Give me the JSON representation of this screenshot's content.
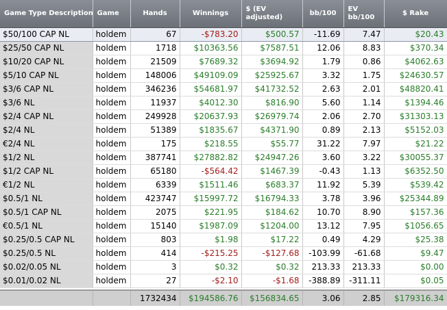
{
  "colors": {
    "positive": "#2a7d2a",
    "negative": "#a41c1c",
    "header_bg": "#7c8189",
    "label_col_bg": "#d9d9d9"
  },
  "headers": [
    "Game Type Description",
    "Game",
    "Hands",
    "Winnings",
    "$ (EV adjusted)",
    "bb/100",
    "EV bb/100",
    "$ Rake"
  ],
  "rows": [
    {
      "desc": "$50/100 CAP NL",
      "game": "holdem",
      "hands": "67",
      "win": "-$783.20",
      "ev": "$500.57",
      "bb": "-11.69",
      "evbb": "7.47",
      "rake": "$20.43"
    },
    {
      "desc": "$25/50 CAP NL",
      "game": "holdem",
      "hands": "1718",
      "win": "$10363.56",
      "ev": "$7587.51",
      "bb": "12.06",
      "evbb": "8.83",
      "rake": "$370.34"
    },
    {
      "desc": "$10/20 CAP NL",
      "game": "holdem",
      "hands": "21509",
      "win": "$7689.32",
      "ev": "$3694.92",
      "bb": "1.79",
      "evbb": "0.86",
      "rake": "$4062.63"
    },
    {
      "desc": "$5/10 CAP NL",
      "game": "holdem",
      "hands": "148006",
      "win": "$49109.09",
      "ev": "$25925.67",
      "bb": "3.32",
      "evbb": "1.75",
      "rake": "$24630.57"
    },
    {
      "desc": "$3/6 CAP NL",
      "game": "holdem",
      "hands": "346236",
      "win": "$54681.97",
      "ev": "$41732.52",
      "bb": "2.63",
      "evbb": "2.01",
      "rake": "$48820.41"
    },
    {
      "desc": "$3/6 NL",
      "game": "holdem",
      "hands": "11937",
      "win": "$4012.30",
      "ev": "$816.90",
      "bb": "5.60",
      "evbb": "1.14",
      "rake": "$1394.46"
    },
    {
      "desc": "$2/4 CAP NL",
      "game": "holdem",
      "hands": "249928",
      "win": "$20637.93",
      "ev": "$26979.74",
      "bb": "2.06",
      "evbb": "2.70",
      "rake": "$31303.13"
    },
    {
      "desc": "$2/4 NL",
      "game": "holdem",
      "hands": "51389",
      "win": "$1835.67",
      "ev": "$4371.90",
      "bb": "0.89",
      "evbb": "2.13",
      "rake": "$5152.03"
    },
    {
      "desc": "€2/4 NL",
      "game": "holdem",
      "hands": "175",
      "win": "$218.55",
      "ev": "$55.77",
      "bb": "31.22",
      "evbb": "7.97",
      "rake": "$21.22"
    },
    {
      "desc": "$1/2 NL",
      "game": "holdem",
      "hands": "387741",
      "win": "$27882.82",
      "ev": "$24947.26",
      "bb": "3.60",
      "evbb": "3.22",
      "rake": "$30055.37"
    },
    {
      "desc": "$1/2 CAP NL",
      "game": "holdem",
      "hands": "65180",
      "win": "-$564.42",
      "ev": "$1467.39",
      "bb": "-0.43",
      "evbb": "1.13",
      "rake": "$6352.50"
    },
    {
      "desc": "€1/2 NL",
      "game": "holdem",
      "hands": "6339",
      "win": "$1511.46",
      "ev": "$683.37",
      "bb": "11.92",
      "evbb": "5.39",
      "rake": "$539.42"
    },
    {
      "desc": "$0.5/1 NL",
      "game": "holdem",
      "hands": "423747",
      "win": "$15997.72",
      "ev": "$16794.33",
      "bb": "3.78",
      "evbb": "3.96",
      "rake": "$25344.89"
    },
    {
      "desc": "$0.5/1 CAP NL",
      "game": "holdem",
      "hands": "2075",
      "win": "$221.95",
      "ev": "$184.62",
      "bb": "10.70",
      "evbb": "8.90",
      "rake": "$157.36"
    },
    {
      "desc": "€0.5/1 NL",
      "game": "holdem",
      "hands": "15140",
      "win": "$1987.09",
      "ev": "$1204.00",
      "bb": "13.12",
      "evbb": "7.95",
      "rake": "$1056.65"
    },
    {
      "desc": "$0.25/0.5 CAP NL",
      "game": "holdem",
      "hands": "803",
      "win": "$1.98",
      "ev": "$17.22",
      "bb": "0.49",
      "evbb": "4.29",
      "rake": "$25.38"
    },
    {
      "desc": "$0.25/0.5 NL",
      "game": "holdem",
      "hands": "414",
      "win": "-$215.25",
      "ev": "-$127.68",
      "bb": "-103.99",
      "evbb": "-61.68",
      "rake": "$9.47"
    },
    {
      "desc": "$0.02/0.05 NL",
      "game": "holdem",
      "hands": "3",
      "win": "$0.32",
      "ev": "$0.32",
      "bb": "213.33",
      "evbb": "213.33",
      "rake": "$0.00"
    },
    {
      "desc": "$0.01/0.02 NL",
      "game": "holdem",
      "hands": "27",
      "win": "-$2.10",
      "ev": "-$1.68",
      "bb": "-388.89",
      "evbb": "-311.11",
      "rake": "$0.05"
    }
  ],
  "totals": {
    "desc": "",
    "game": "",
    "hands": "1732434",
    "win": "$194586.76",
    "ev": "$156834.65",
    "bb": "3.06",
    "evbb": "2.85",
    "rake": "$179316.34"
  }
}
